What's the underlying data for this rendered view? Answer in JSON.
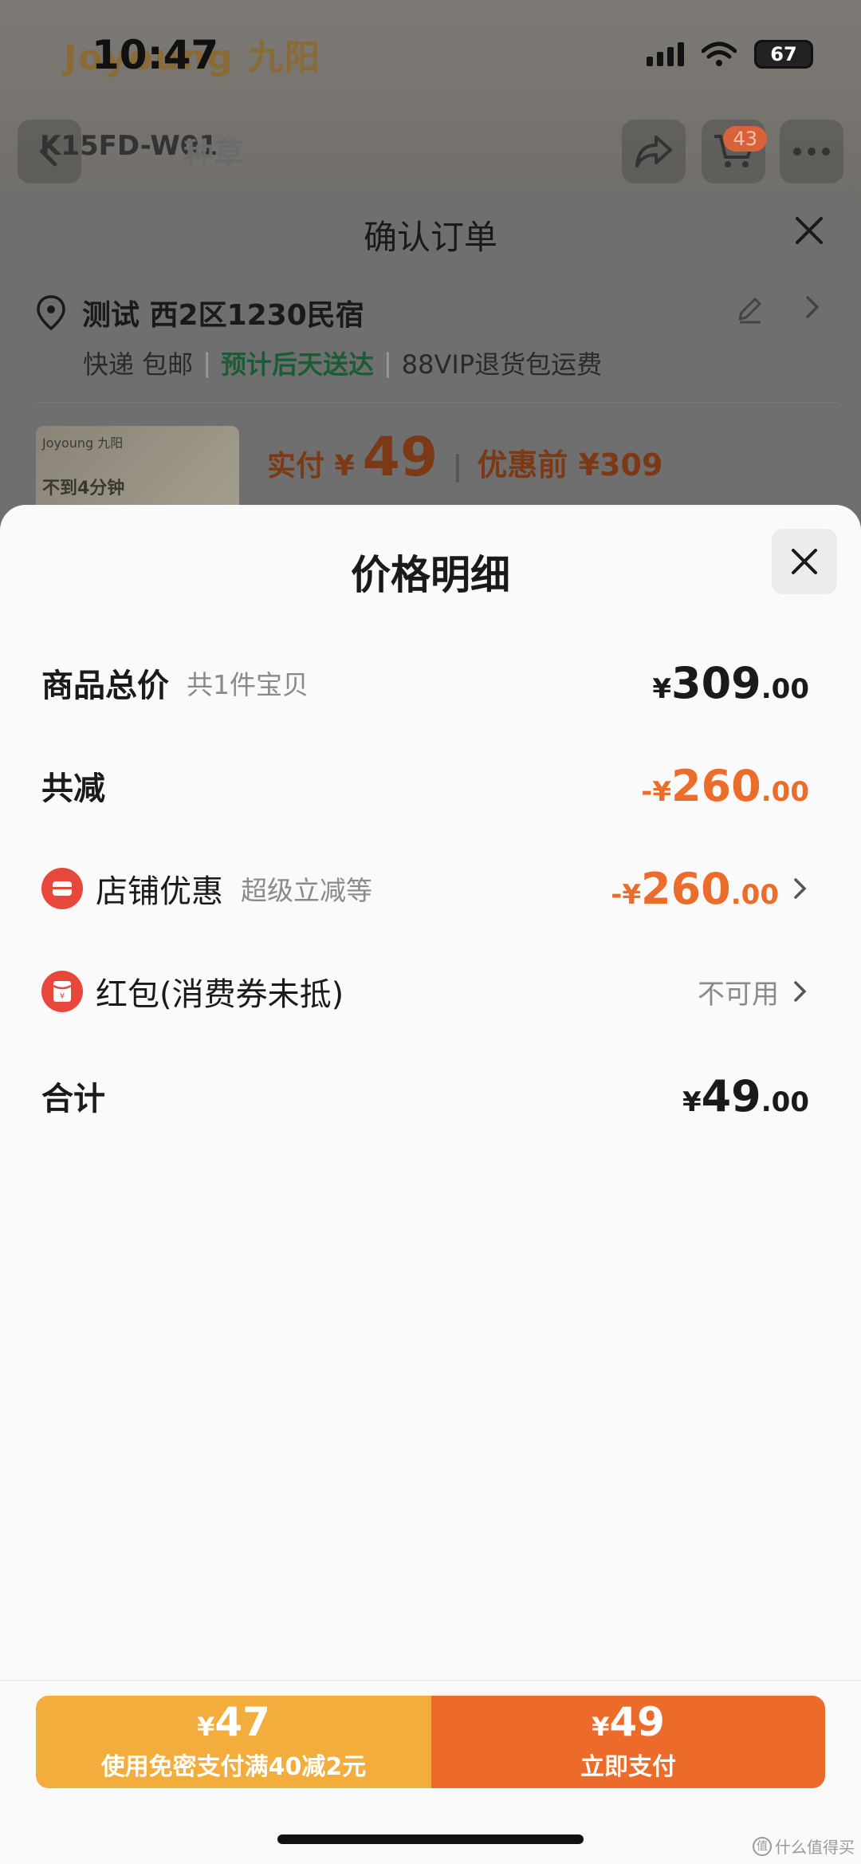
{
  "status_bar": {
    "time": "10:47",
    "battery": "67"
  },
  "background_page": {
    "brand": "Joyoung 九阳",
    "model": "K15FD-W01",
    "tag": "种草",
    "cart_count": "43"
  },
  "order_sheet": {
    "title": "确认订单",
    "address": "测试 西2区1230民宿",
    "shipping": "快递 包邮",
    "eta": "预计后天送达",
    "return_policy": "88VIP退货包运费",
    "thumb_brand": "Joyoung 九阳",
    "thumb_promo": "不到4分钟",
    "actual_pay_label": "实付 ¥",
    "actual_pay_value": "49",
    "before_discount": "优惠前 ¥309"
  },
  "detail_sheet": {
    "title": "价格明细",
    "rows": {
      "goods_total": {
        "label": "商品总价",
        "sub": "共1件宝贝",
        "sym": "¥",
        "int": "309",
        "dec": ".00"
      },
      "total_reduction": {
        "label": "共减",
        "sym": "-¥",
        "int": "260",
        "dec": ".00"
      },
      "shop_discount": {
        "label": "店铺优惠",
        "sub": "超级立减等",
        "sym": "-¥",
        "int": "260",
        "dec": ".00"
      },
      "red_packet": {
        "label": "红包(消费券未抵)",
        "status": "不可用"
      },
      "sum": {
        "label": "合计",
        "sym": "¥",
        "int": "49",
        "dec": ".00"
      }
    }
  },
  "pay_bar": {
    "left": {
      "sym": "¥",
      "int": "47",
      "sub": "使用免密支付满40减2元"
    },
    "right": {
      "sym": "¥",
      "int": "49",
      "sub": "立即支付"
    }
  },
  "watermark": {
    "badge": "值",
    "text": "什么值得买"
  },
  "colors": {
    "discount_orange": "#ec6d2b",
    "pay_left": "#f2ad3c",
    "pay_right": "#ec6b2a",
    "eta_green": "#1b5c36"
  }
}
